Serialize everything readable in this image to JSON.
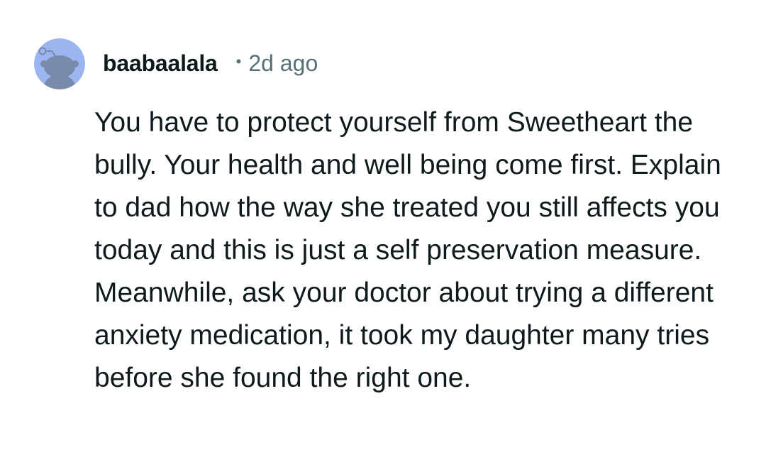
{
  "comment": {
    "avatar_icon": "reddit-snoo-avatar-icon",
    "username": "baabaalala",
    "separator": "•",
    "timestamp": "2d ago",
    "body": "You have to protect yourself from Sweetheart the bully. Your health and well being come first. Explain to dad how the way she treated you still affects you today and this is just a self preservation measure. Meanwhile, ask your doctor about trying a different anxiety medication, it took my daughter many tries before she found the right one."
  },
  "colors": {
    "avatar_background": "#9cb4f0",
    "avatar_figure": "#7a8aac",
    "username": "#0f1a1c",
    "metadata": "#576f76",
    "body_text": "#0f1a1c",
    "page_background": "#ffffff"
  }
}
